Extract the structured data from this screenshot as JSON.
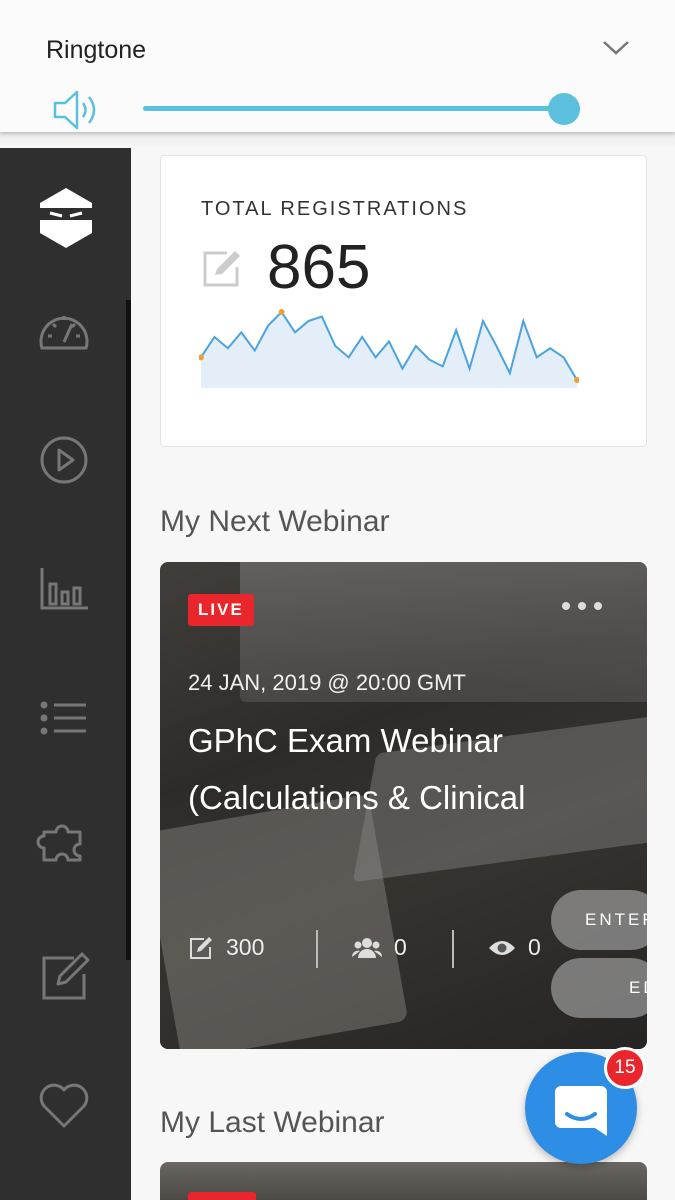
{
  "volume_panel": {
    "label": "Ringtone",
    "level_percent": 100
  },
  "sidebar": {
    "items": [
      {
        "icon": "dashboard-gauge-icon"
      },
      {
        "icon": "play-circle-icon"
      },
      {
        "icon": "bar-chart-icon"
      },
      {
        "icon": "list-icon"
      },
      {
        "icon": "puzzle-piece-icon"
      },
      {
        "icon": "edit-icon"
      },
      {
        "icon": "heart-icon"
      }
    ]
  },
  "stats": {
    "title": "TOTAL REGISTRATIONS",
    "value": "865",
    "sparkline": [
      30,
      48,
      38,
      52,
      36,
      58,
      70,
      52,
      62,
      66,
      40,
      30,
      48,
      30,
      44,
      20,
      40,
      28,
      22,
      54,
      20,
      62,
      40,
      16,
      62,
      30,
      38,
      30,
      10
    ]
  },
  "next_webinar": {
    "heading": "My Next Webinar",
    "badge": "LIVE",
    "date": "24 JAN, 2019 @ 20:00 GMT",
    "title_line1": "GPhC Exam Webinar",
    "title_line2": "(Calculations & Clinical",
    "registrations": "300",
    "attendees": "0",
    "views": "0",
    "enter_label": "ENTER",
    "edit_label": "EDIT"
  },
  "last_webinar": {
    "heading": "My Last Webinar"
  },
  "chat": {
    "unread_count": "15"
  },
  "colors": {
    "accent": "#5bc0de",
    "live": "#e8262b",
    "chat": "#2e8de4",
    "sidebar": "#2f2f2f"
  }
}
